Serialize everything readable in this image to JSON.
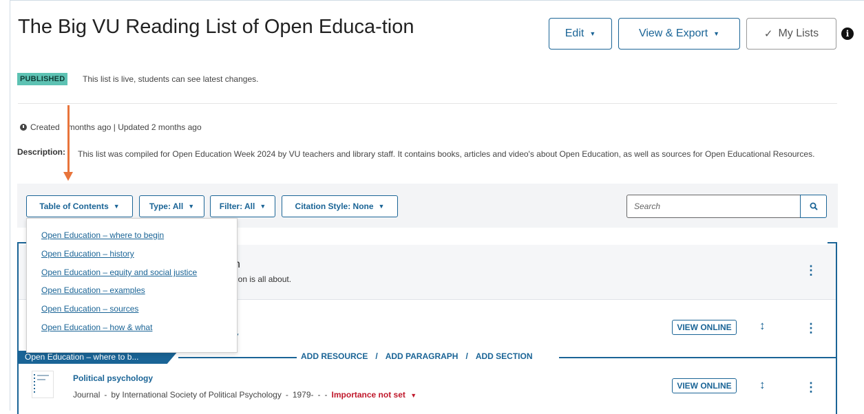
{
  "header": {
    "title": "The Big VU Reading List of Open Educa-tion",
    "buttons": {
      "edit": "Edit",
      "view_export": "View & Export",
      "my_lists": "My Lists"
    },
    "status_badge": "PUBLISHED",
    "status_text": "This list is live, students can see latest changes."
  },
  "meta": {
    "created_prefix": "Created",
    "created_rest": "months ago | Updated 2 months ago"
  },
  "description": {
    "label": "Description:",
    "text": "This list was compiled for Open Education Week 2024 by VU teachers and library staff. It contains books, articles and video's about Open Education, as well as sources for Open Educational Resources."
  },
  "toolbar": {
    "toc": "Table of Contents",
    "type": "Type: All",
    "filter": "Filter: All",
    "citation": "Citation Style: None",
    "search_placeholder": "Search"
  },
  "toc_menu": [
    "Open Education – where to begin",
    "Open Education – history",
    "Open Education – equity and social justice",
    "Open Education – examples",
    "Open Education – sources",
    "Open Education – how & what"
  ],
  "paragraph": {
    "title_partial": "n",
    "text_partial": "ition is all about."
  },
  "section": {
    "tab_label": "Open Education – where to b...",
    "add_resource": "ADD RESOURCE",
    "add_paragraph": "ADD PARAGRAPH",
    "add_section": "ADD SECTION",
    "separator": "/"
  },
  "resource": {
    "title": "Political psychology",
    "type": "Journal",
    "author": "by International Society of Political Psychology",
    "year": "1979-",
    "dash": "-",
    "importance": "Importance not set"
  },
  "view_online": "VIEW ONLINE",
  "colors": {
    "accent": "#1a6496",
    "badge": "#5dc2b3",
    "annotation_arrow": "#e8743b",
    "importance": "#c0192c"
  },
  "icons": [
    "chevron-down-icon",
    "check-icon",
    "info-icon",
    "clock-icon",
    "search-icon",
    "vertical-move-icon",
    "more-vertical-icon",
    "document-icon"
  ]
}
